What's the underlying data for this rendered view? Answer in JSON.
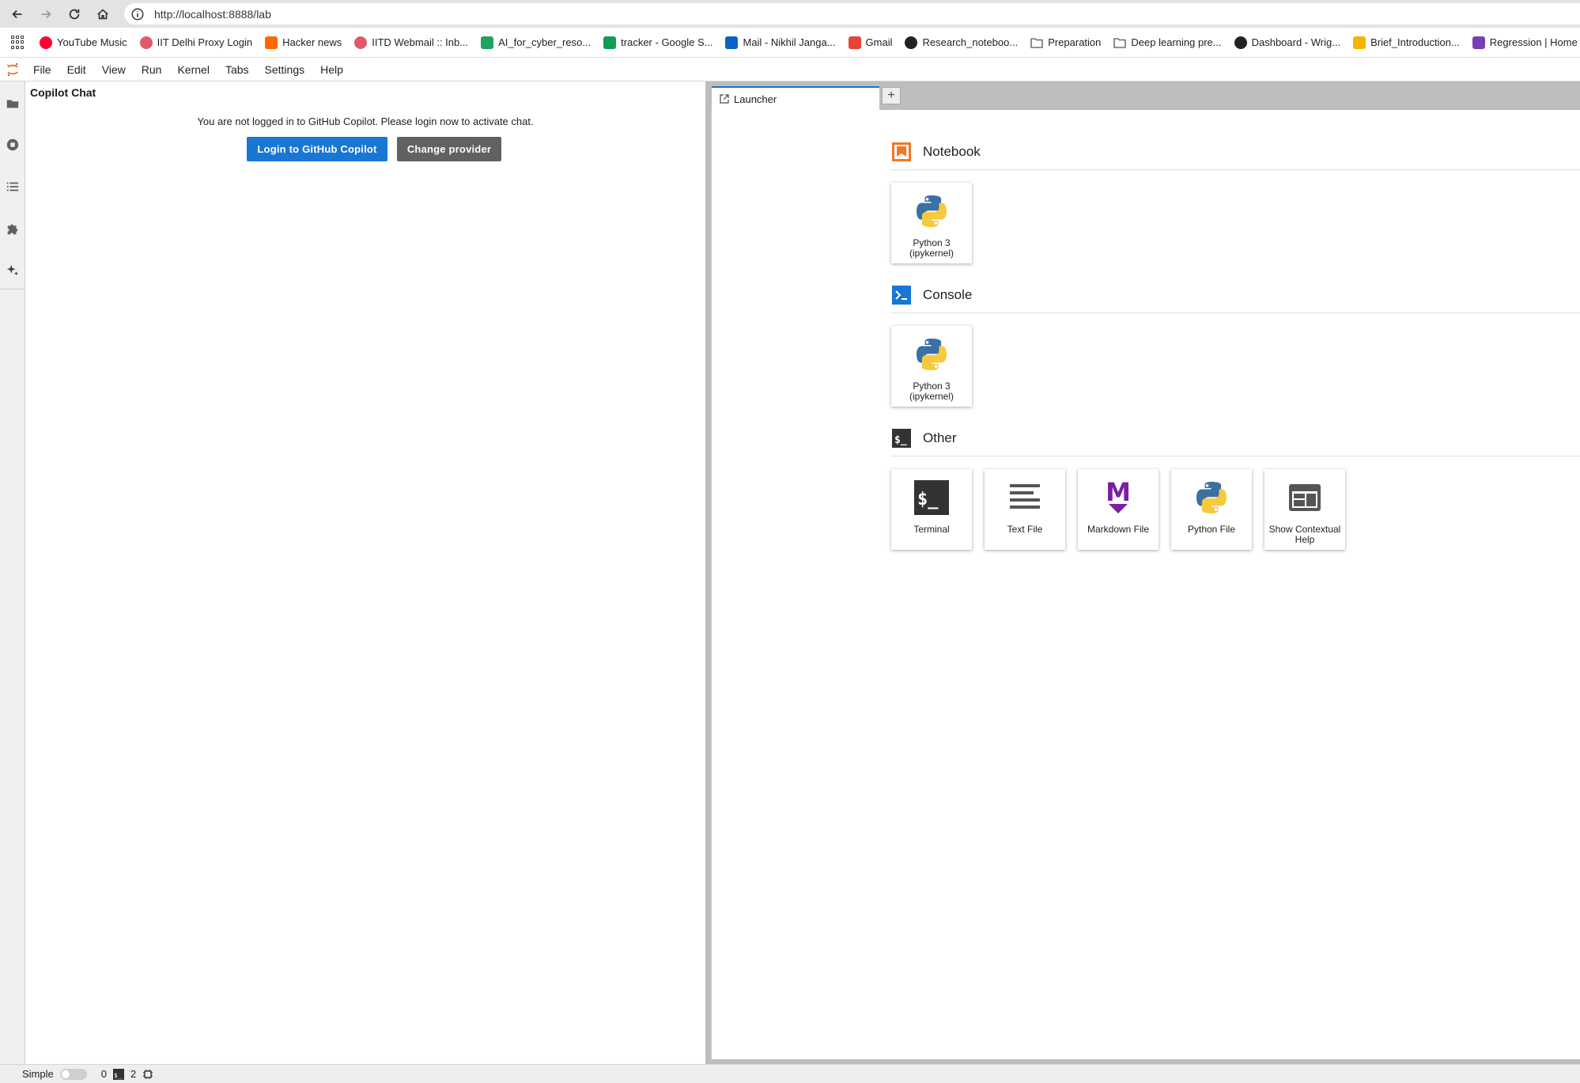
{
  "browser": {
    "url": "http://localhost:8888/lab",
    "bookmarks": [
      {
        "label": "YouTube Music",
        "icon": "youtube-music-icon",
        "color": "#ff0033"
      },
      {
        "label": "IIT Delhi Proxy Login",
        "icon": "proxy-icon",
        "color": "#e05a6a"
      },
      {
        "label": "Hacker news",
        "icon": "hacker-news-icon",
        "color": "#ff6600"
      },
      {
        "label": "IITD Webmail :: Inb...",
        "icon": "webmail-icon",
        "color": "#e05a6a"
      },
      {
        "label": "AI_for_cyber_reso...",
        "icon": "google-drive-icon",
        "color": "#1fa463"
      },
      {
        "label": "tracker - Google S...",
        "icon": "google-sheets-icon",
        "color": "#0f9d58"
      },
      {
        "label": "Mail - Nikhil Janga...",
        "icon": "outlook-icon",
        "color": "#0a64c8"
      },
      {
        "label": "Gmail",
        "icon": "gmail-icon",
        "color": "#ea4335"
      },
      {
        "label": "Research_noteboo...",
        "icon": "github-icon",
        "color": "#222222"
      },
      {
        "label": "Preparation",
        "icon": "folder-icon",
        "color": "#555555"
      },
      {
        "label": "Deep learning pre...",
        "icon": "folder-icon",
        "color": "#555555"
      },
      {
        "label": "Dashboard - Wrig...",
        "icon": "globe-icon",
        "color": "#222222"
      },
      {
        "label": "Brief_Introduction...",
        "icon": "slides-icon",
        "color": "#f4b400"
      },
      {
        "label": "Regression | Home",
        "icon": "regression-icon",
        "color": "#7b3fb5"
      }
    ]
  },
  "menubar": {
    "items": [
      "File",
      "Edit",
      "View",
      "Run",
      "Kernel",
      "Tabs",
      "Settings",
      "Help"
    ]
  },
  "copilot": {
    "title": "Copilot Chat",
    "message": "You are not logged in to GitHub Copilot. Please login now to activate chat.",
    "login_label": "Login to GitHub Copilot",
    "change_label": "Change provider"
  },
  "tabs": {
    "active_label": "Launcher",
    "add_label": "+"
  },
  "launcher": {
    "notebook": {
      "title": "Notebook",
      "cards": [
        {
          "label": "Python 3 (ipykernel)"
        }
      ]
    },
    "console": {
      "title": "Console",
      "cards": [
        {
          "label": "Python 3 (ipykernel)"
        }
      ]
    },
    "other": {
      "title": "Other",
      "cards": [
        {
          "label": "Terminal"
        },
        {
          "label": "Text File"
        },
        {
          "label": "Markdown File"
        },
        {
          "label": "Python File"
        },
        {
          "label": "Show Contextual Help"
        }
      ]
    }
  },
  "statusbar": {
    "mode_label": "Simple",
    "terminals": "0",
    "kernels": "2"
  },
  "colors": {
    "accent": "#1976d2",
    "notebook_icon": "#f37726",
    "console_icon": "#1976d2",
    "markdown_icon": "#7b1fa2"
  }
}
